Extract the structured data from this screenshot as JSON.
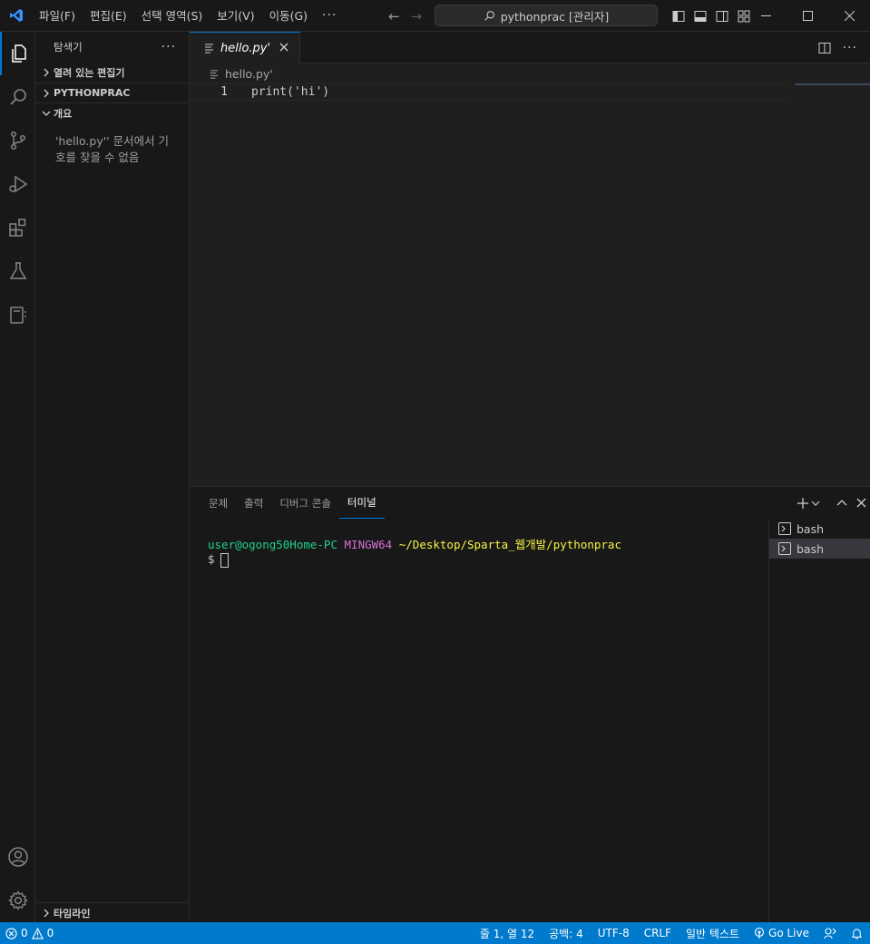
{
  "titlebar": {
    "menu": [
      "파일(F)",
      "편집(E)",
      "선택 영역(S)",
      "보기(V)",
      "이동(G)"
    ],
    "more": "···",
    "command_center": "pythonprac [관리자]"
  },
  "colors": {
    "accent": "#0078d4",
    "statusbar": "#007acc",
    "logo": "#3794ff",
    "term_green": "#23d18b",
    "term_magenta": "#d670d6",
    "term_yellow": "#f5f543"
  },
  "sidebar": {
    "title": "탐색기",
    "more": "···",
    "sections": {
      "open_editors": "열려 있는 편집기",
      "project": "PYTHONPRAC",
      "outline": "개요",
      "timeline": "타임라인"
    },
    "outline_message": "'hello.py'' 문서에서 기호를 찾을 수 없음"
  },
  "editor": {
    "tab_label": "hello.py'",
    "breadcrumb": "hello.py'",
    "lines": [
      {
        "num": "1",
        "code": "print('hi')"
      }
    ]
  },
  "panel": {
    "tabs": [
      "문제",
      "출력",
      "디버그 콘솔",
      "터미널"
    ],
    "active_tab": "터미널",
    "terminal": {
      "user": "user@ogong50Home-PC",
      "env": "MINGW64",
      "path": "~/Desktop/Sparta_웹개발/pythonprac",
      "prompt": "$"
    },
    "terminal_list": [
      "bash",
      "bash"
    ]
  },
  "statusbar": {
    "errors": "0",
    "warnings": "0",
    "position": "줄 1, 열 12",
    "spaces": "공백: 4",
    "encoding": "UTF-8",
    "eol": "CRLF",
    "language": "일반 텍스트",
    "golive": "Go Live"
  }
}
